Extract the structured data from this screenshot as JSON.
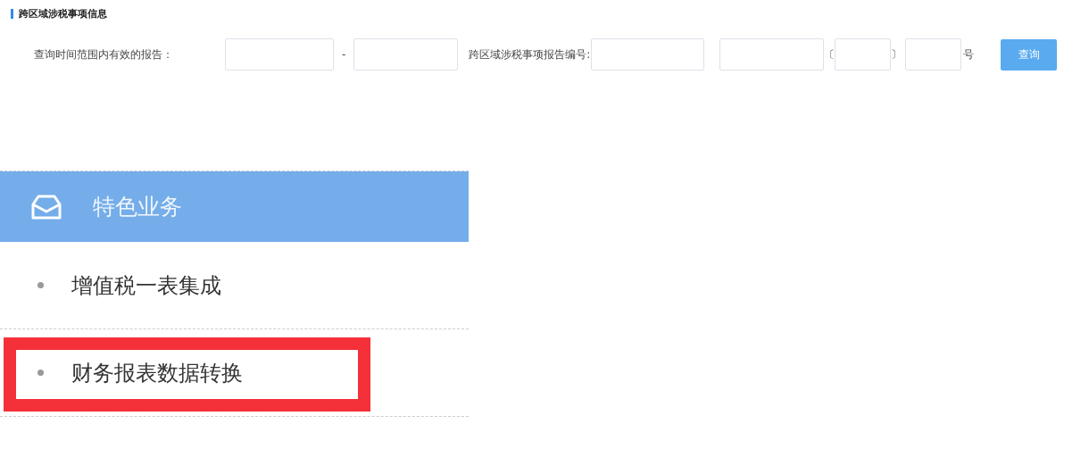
{
  "section": {
    "title": "跨区域涉税事项信息"
  },
  "query_form": {
    "date_label": "查询时间范围内有效的报告：",
    "date_separator": "-",
    "number_label": "跨区域涉税事项报告编号:",
    "open_bracket": "〔",
    "close_bracket": "〕",
    "number_suffix": "号",
    "button": "查询"
  },
  "sidebar": {
    "header": "特色业务",
    "items": [
      {
        "label": "增值税一表集成",
        "highlighted": false
      },
      {
        "label": "财务报表数据转换",
        "highlighted": true
      }
    ]
  }
}
